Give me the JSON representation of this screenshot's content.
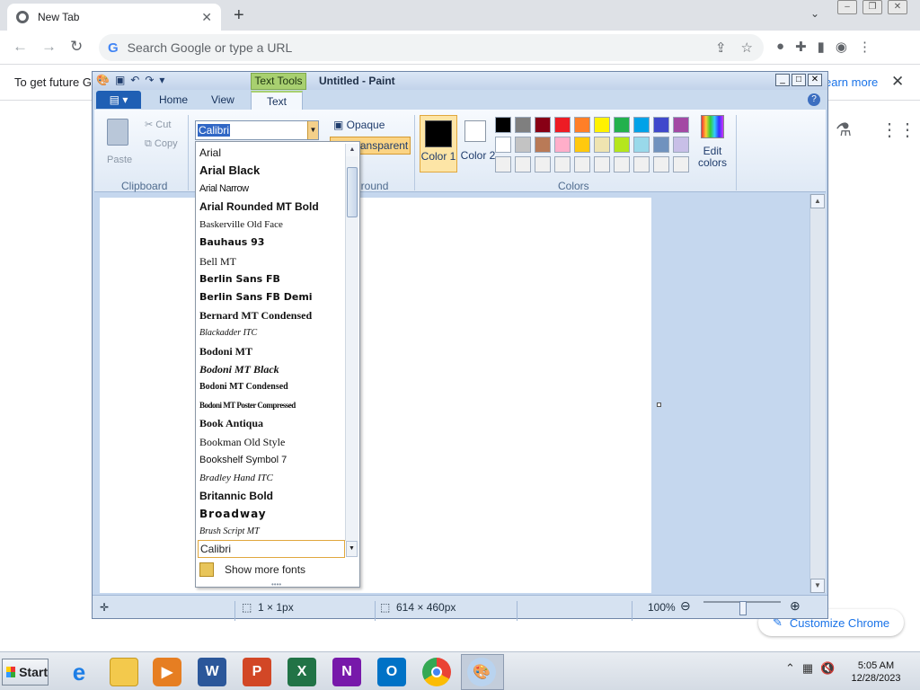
{
  "browser": {
    "tab_title": "New Tab",
    "omnibox_placeholder": "Search Google or type a URL",
    "infobar_text": "To get future Go",
    "infobar_link": "earn more",
    "customize_label": "Customize Chrome"
  },
  "paint": {
    "title": "Untitled - Paint",
    "context_tab_group": "Text Tools",
    "tabs": {
      "home": "Home",
      "view": "View",
      "text": "Text"
    },
    "clipboard": {
      "paste": "Paste",
      "cut": "Cut",
      "copy": "Copy",
      "group": "Clipboard"
    },
    "background": {
      "opaque": "Opaque",
      "transparent": "Transparent",
      "group": "ground"
    },
    "colors": {
      "color1": "Color 1",
      "color2": "Color 2",
      "edit": "Edit colors",
      "group": "Colors",
      "color1_value": "#000000",
      "color2_value": "#ffffff",
      "palette": [
        "#000000",
        "#7f7f7f",
        "#880015",
        "#ed1c24",
        "#ff7f27",
        "#fff200",
        "#22b14c",
        "#00a2e8",
        "#3f48cc",
        "#a349a4",
        "#ffffff",
        "#c3c3c3",
        "#b97a57",
        "#ffaec9",
        "#ffc90e",
        "#efe4b0",
        "#b5e61d",
        "#99d9ea",
        "#7092be",
        "#c8bfe7",
        "#f0f0f0",
        "#f0f0f0",
        "#f0f0f0",
        "#f0f0f0",
        "#f0f0f0",
        "#f0f0f0",
        "#f0f0f0",
        "#f0f0f0",
        "#f0f0f0",
        "#f0f0f0"
      ]
    },
    "font_combo_value": "Calibri",
    "font_list": [
      "Arial",
      "Arial Black",
      "Arial Narrow",
      "Arial Rounded MT Bold",
      "Baskerville Old Face",
      "Bauhaus 93",
      "Bell MT",
      "Berlin Sans FB",
      "Berlin Sans FB Demi",
      "Bernard MT Condensed",
      "Blackadder ITC",
      "Bodoni MT",
      "Bodoni MT Black",
      "Bodoni MT Condensed",
      "Bodoni MT Poster Compressed",
      "Book Antiqua",
      "Bookman Old Style",
      "Bookshelf Symbol 7",
      "Bradley Hand ITC",
      "Britannic Bold",
      "Broadway",
      "Brush Script MT"
    ],
    "font_input_value": "Calibri",
    "show_more_fonts": "Show more fonts",
    "status": {
      "selection": "1 × 1px",
      "canvas_size": "614 × 460px",
      "zoom": "100%"
    }
  },
  "taskbar": {
    "start": "Start",
    "time": "5:05 AM",
    "date": "12/28/2023"
  }
}
